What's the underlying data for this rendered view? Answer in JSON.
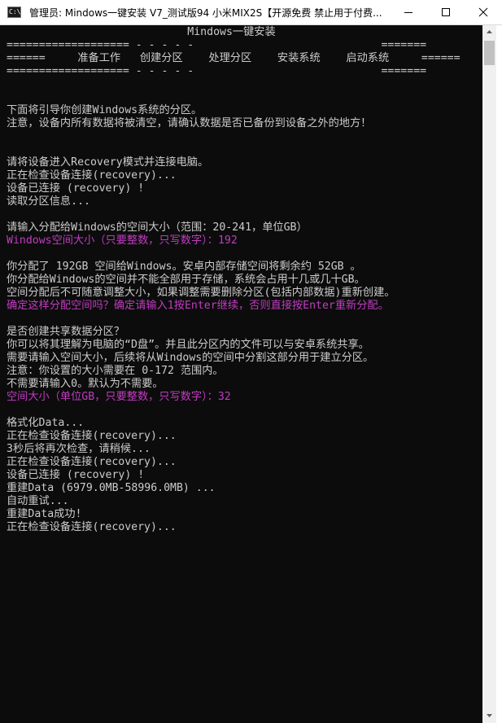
{
  "window": {
    "title": "管理员:  Mindows一键安装 V7_测试版94 小米MIX2S【开源免费 禁止用于付费..."
  },
  "console": {
    "lines": [
      {
        "text": "                            Mindows一键安装",
        "color": "normal"
      },
      {
        "text": "=================== - - - - -                             =======",
        "color": "normal"
      },
      {
        "text": "======     准备工作   创建分区    处理分区    安装系统    启动系统     ======",
        "color": "normal"
      },
      {
        "text": "=================== - - - - -                             =======",
        "color": "normal"
      },
      {
        "text": "",
        "color": "normal"
      },
      {
        "text": "",
        "color": "normal"
      },
      {
        "text": "下面将引导你创建Windows系统的分区。",
        "color": "normal"
      },
      {
        "text": "注意，设备内所有数据将被清空，请确认数据是否已备份到设备之外的地方！",
        "color": "normal"
      },
      {
        "text": "",
        "color": "normal"
      },
      {
        "text": "",
        "color": "normal"
      },
      {
        "text": "请将设备进入Recovery模式并连接电脑。",
        "color": "normal"
      },
      {
        "text": "正在检查设备连接(recovery)...",
        "color": "normal"
      },
      {
        "text": "设备已连接 (recovery) !",
        "color": "normal"
      },
      {
        "text": "读取分区信息...",
        "color": "normal"
      },
      {
        "text": "",
        "color": "normal"
      },
      {
        "text": "请输入分配给Windows的空间大小（范围：20-241，单位GB）",
        "color": "normal"
      },
      {
        "text": "Windows空间大小（只要整数，只写数字）：192",
        "color": "magenta"
      },
      {
        "text": "",
        "color": "normal"
      },
      {
        "text": "你分配了 192GB 空间给Windows。安卓内部存储空间将剩余约 52GB 。",
        "color": "normal"
      },
      {
        "text": "你分配给Windows的空间并不能全部用于存储，系统会占用十几或几十GB。",
        "color": "normal"
      },
      {
        "text": "空间分配后不可随意调整大小，如果调整需要删除分区(包括内部数据)重新创建。",
        "color": "normal"
      },
      {
        "text": "确定这样分配空间吗？确定请输入1按Enter继续，否则直接按Enter重新分配。",
        "color": "magenta"
      },
      {
        "text": "",
        "color": "normal"
      },
      {
        "text": "是否创建共享数据分区？",
        "color": "normal"
      },
      {
        "text": "你可以将其理解为电脑的“D盘”。并且此分区内的文件可以与安卓系统共享。",
        "color": "normal"
      },
      {
        "text": "需要请输入空间大小，后续将从Windows的空间中分割这部分用于建立分区。",
        "color": "normal"
      },
      {
        "text": "注意：你设置的大小需要在 0-172 范围内。",
        "color": "normal"
      },
      {
        "text": "不需要请输入0。默认为不需要。",
        "color": "normal"
      },
      {
        "text": "空间大小（单位GB，只要整数，只写数字）：32",
        "color": "magenta"
      },
      {
        "text": "",
        "color": "normal"
      },
      {
        "text": "格式化Data...",
        "color": "normal"
      },
      {
        "text": "正在检查设备连接(recovery)...",
        "color": "normal"
      },
      {
        "text": "3秒后将再次检查，请稍候...",
        "color": "normal"
      },
      {
        "text": "正在检查设备连接(recovery)...",
        "color": "normal"
      },
      {
        "text": "设备已连接 (recovery) !",
        "color": "normal"
      },
      {
        "text": "重建Data (6979.0MB-58996.0MB) ...",
        "color": "normal"
      },
      {
        "text": "自动重试...",
        "color": "normal"
      },
      {
        "text": "重建Data成功!",
        "color": "normal"
      },
      {
        "text": "正在检查设备连接(recovery)...",
        "color": "normal"
      }
    ]
  },
  "colors": {
    "console_bg": "#0c0c0c",
    "console_text": "#cccccc",
    "console_prompt": "#c03cc0",
    "titlebar_bg": "#ffffff"
  },
  "icons": {
    "app": "console-icon",
    "minimize": "minimize-icon",
    "maximize": "maximize-icon",
    "close": "close-icon"
  }
}
